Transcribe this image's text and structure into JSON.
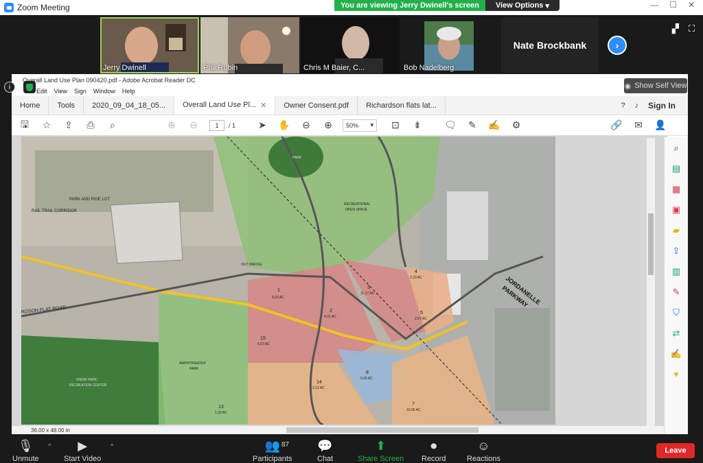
{
  "window": {
    "title": "Zoom Meeting"
  },
  "banner": {
    "viewing": "You are viewing Jerry Dwinell's screen",
    "view_options": "View Options"
  },
  "participants": [
    {
      "name": "Jerry Dwinell"
    },
    {
      "name": "Phil Rubin"
    },
    {
      "name": "Chris M Baier, C..."
    },
    {
      "name": "Bob Nadelberg"
    }
  ],
  "nate": {
    "name": "Nate Brockbank"
  },
  "acrobat": {
    "title": "Overall Land Use Plan 090420.pdf - Adobe Acrobat Reader DC",
    "menu": [
      "Edit",
      "View",
      "Sign",
      "Window",
      "Help"
    ],
    "show_self_view": "Show Self View",
    "tabs": [
      "Home",
      "Tools",
      "2020_09_04_18_05...",
      "Overall Land Use Pl...",
      "Owner Consent.pdf",
      "Richardson flats lat..."
    ],
    "sign_in": "Sign In",
    "page_current": "1",
    "page_total": "/ 1",
    "zoom": "50%",
    "page_size": "36.00 x 48.00 in"
  },
  "map_labels": {
    "park_ride": "PARK AND RIDE LOT",
    "rail_trail": "RAIL TRAIL CORRIDOR",
    "park": "PARK",
    "recreational": "RECREATIONAL",
    "open_space": "OPEN SPACE",
    "out_parcel": "OUT PARCEL",
    "jordanelle": "JORDANELLE",
    "parkway": "PARKWAY",
    "road": "RDSON FLAT ROAD",
    "amphitheater": "AMPHITHEATER",
    "amph_park": "PARK",
    "snow": "SNOW PARK",
    "snow2": "RECREATION CENTER",
    "p1": "1",
    "p1a": "5.03 AC",
    "p2": "2",
    "p2a": "4.31 AC",
    "p3": "3",
    "p3a": "11.17 AC",
    "p4": "4",
    "p4a": "2.33 AC",
    "p5": "5",
    "p5a": "2.57 AC",
    "p15": "15",
    "p15a": "5.07 AC",
    "p8": "8",
    "p8a": "5.06 AC",
    "p14": "14",
    "p14a": "2.12 AC",
    "p7": "7",
    "p7a": "10.65 AC",
    "p13": "13",
    "p13a": "1.33 AC"
  },
  "controls": {
    "unmute": "Unmute",
    "start_video": "Start Video",
    "participants": "Participants",
    "participant_count": "87",
    "chat": "Chat",
    "share_screen": "Share Screen",
    "record": "Record",
    "reactions": "Reactions",
    "leave": "Leave"
  },
  "colors": {
    "share_green": "#23b04a",
    "leave_red": "#e02828",
    "zoom_blue": "#2d8cff"
  }
}
